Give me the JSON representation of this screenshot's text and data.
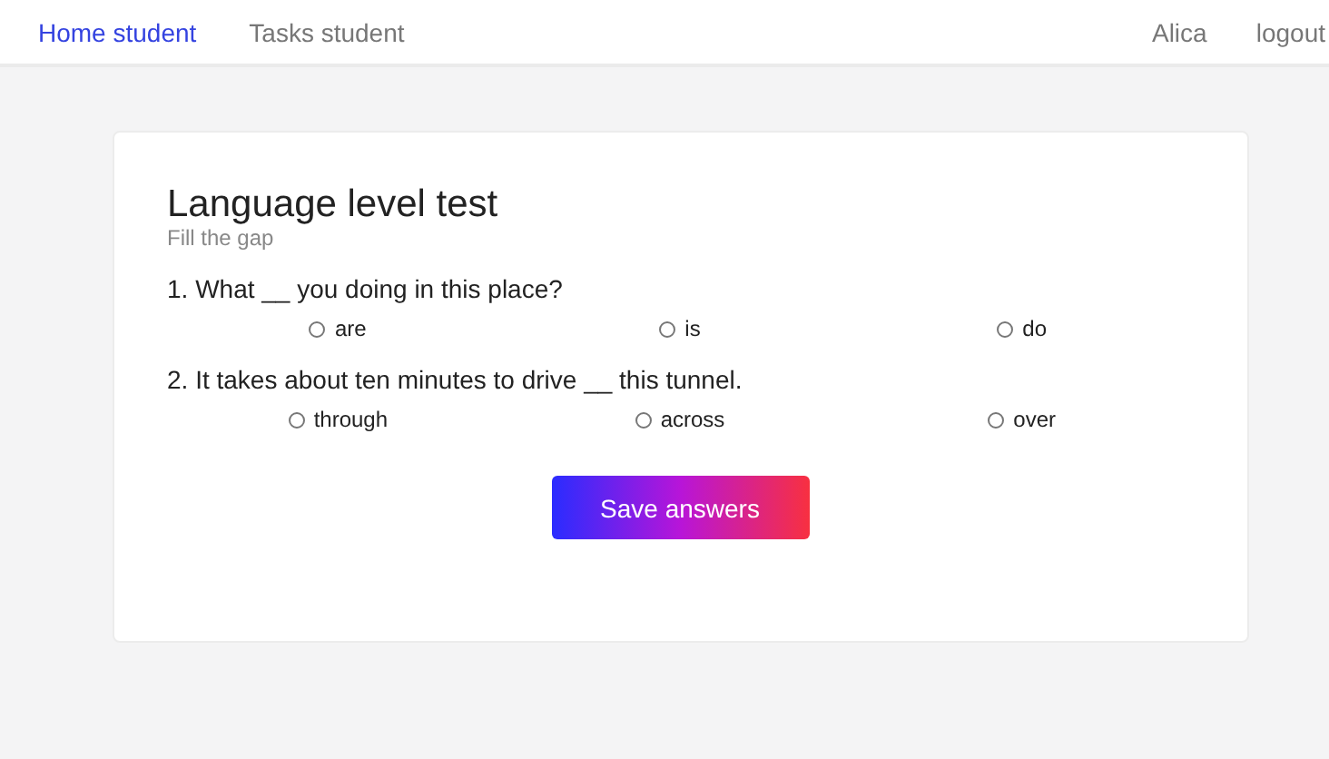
{
  "nav": {
    "left": [
      {
        "label": "Home student",
        "selected": true
      },
      {
        "label": "Tasks student",
        "selected": false
      }
    ],
    "right": [
      {
        "label": "Alica"
      },
      {
        "label": "logout"
      }
    ]
  },
  "test": {
    "title": "Language level test",
    "subtitle": "Fill the gap",
    "questions": [
      {
        "text": "1. What __ you doing in this place?",
        "options": [
          {
            "label": "are",
            "selected": false
          },
          {
            "label": "is",
            "selected": false
          },
          {
            "label": "do",
            "selected": false
          }
        ]
      },
      {
        "text": "2. It takes about ten minutes to drive __ this tunnel.",
        "options": [
          {
            "label": "through",
            "selected": false
          },
          {
            "label": "across",
            "selected": false
          },
          {
            "label": "over",
            "selected": false
          }
        ]
      }
    ],
    "button": "Save answers"
  }
}
